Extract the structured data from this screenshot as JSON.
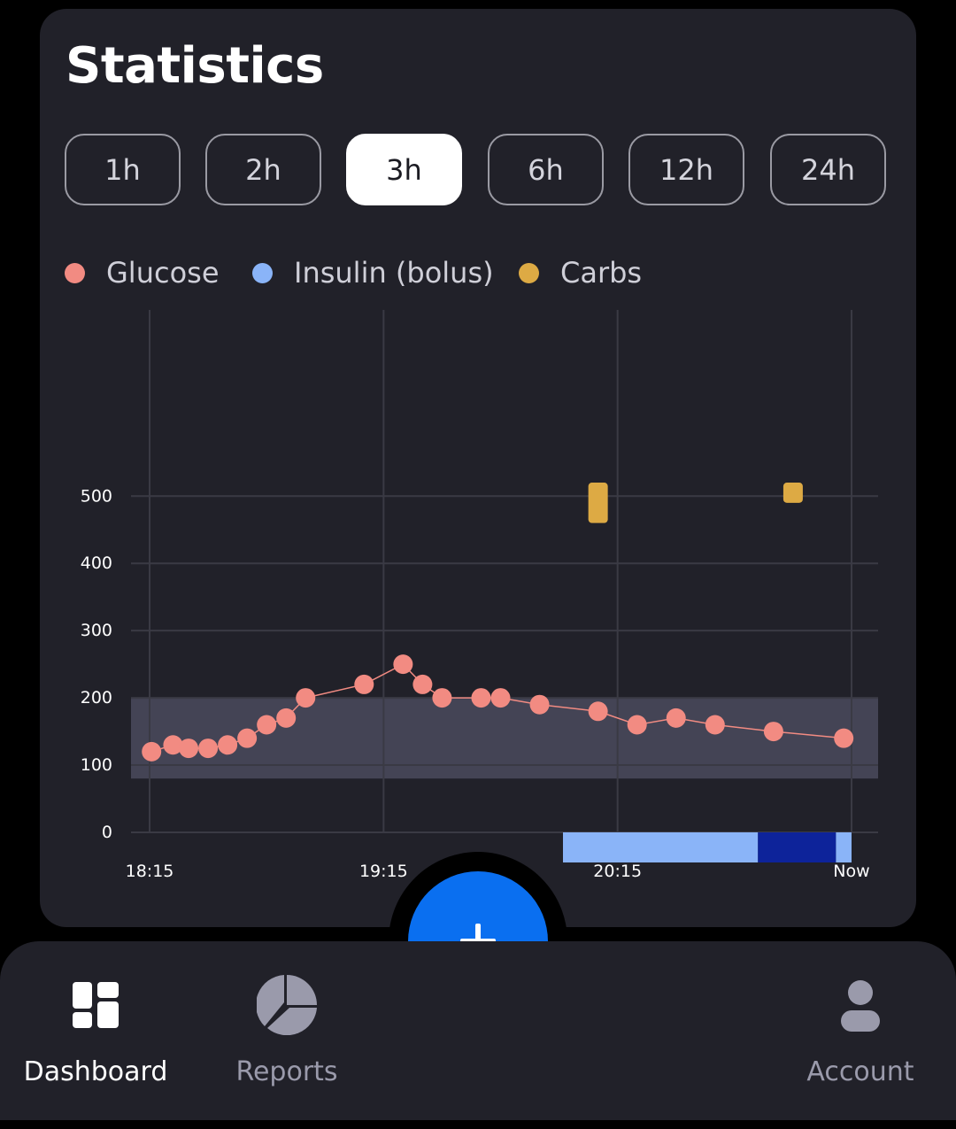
{
  "title": "Statistics",
  "ranges": [
    {
      "label": "1h",
      "active": false
    },
    {
      "label": "2h",
      "active": false
    },
    {
      "label": "3h",
      "active": true
    },
    {
      "label": "6h",
      "active": false
    },
    {
      "label": "12h",
      "active": false
    },
    {
      "label": "24h",
      "active": false
    }
  ],
  "legend": [
    {
      "label": "Glucose",
      "color": "#f28b82"
    },
    {
      "label": "Insulin (bolus)",
      "color": "#8ab4f8"
    },
    {
      "label": "Carbs",
      "color": "#ddaa44"
    }
  ],
  "chart_data": {
    "type": "scatter",
    "y_ticks": [
      "500",
      "400",
      "300",
      "200",
      "100",
      "0"
    ],
    "ylim": [
      0,
      500
    ],
    "x_ticks": [
      "18:15",
      "19:15",
      "20:15",
      "Now"
    ],
    "x_range_minutes": [
      0,
      180
    ],
    "target_range": [
      80,
      200
    ],
    "grid": true,
    "series": [
      {
        "name": "Glucose",
        "color": "#f28b82",
        "x": [
          0.5,
          6,
          10,
          15,
          20,
          25,
          30,
          35,
          40,
          55,
          65,
          70,
          75,
          85,
          90,
          100,
          115,
          125,
          135,
          145,
          160,
          178
        ],
        "y": [
          120,
          130,
          125,
          125,
          130,
          140,
          160,
          170,
          200,
          220,
          250,
          220,
          200,
          200,
          200,
          190,
          180,
          160,
          170,
          160,
          150,
          140
        ]
      },
      {
        "name": "Carbs",
        "color": "#ddaa44",
        "x": [
          115,
          165
        ],
        "y_top": [
          520,
          520
        ],
        "y_bottom": [
          460,
          490
        ]
      }
    ],
    "insulin_bar": {
      "segments": [
        {
          "start": 106,
          "end": 156,
          "color": "#8ab4f8"
        },
        {
          "start": 156,
          "end": 176,
          "color": "#0d239a"
        },
        {
          "start": 176,
          "end": 180,
          "color": "#8ab4f8"
        }
      ]
    }
  },
  "fab": {
    "label": "+"
  },
  "nav": [
    {
      "label": "Dashboard",
      "icon": "dashboard-icon",
      "active": true
    },
    {
      "label": "Reports",
      "icon": "pie-chart-icon",
      "active": false
    },
    {
      "label": "Account",
      "icon": "person-icon",
      "active": false
    }
  ],
  "colors": {
    "background": "#000000",
    "card": "#212129",
    "accent": "#0a6ff0",
    "target_band": "#444455",
    "grid": "#3a3a44",
    "nav_active": "#ffffff",
    "nav_inactive": "#9a9aab"
  }
}
